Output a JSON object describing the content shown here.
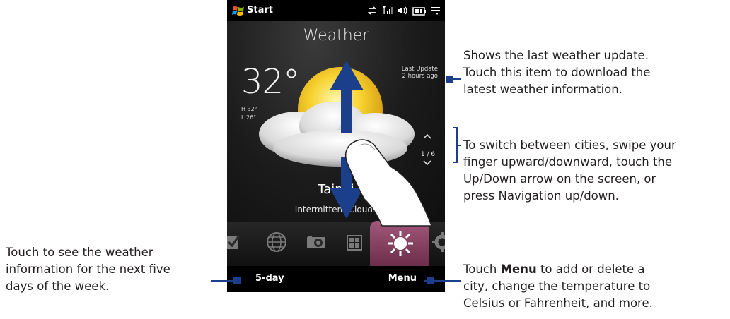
{
  "status_bar": {
    "start_label": "Start"
  },
  "weather": {
    "title": "Weather",
    "temperature": "32°",
    "high": "H 32°",
    "low": "L 26°",
    "last_update_line1": "Last Update",
    "last_update_line2": "2 hours ago",
    "city_page": "1 / 6",
    "city": "Taipei",
    "condition": "Intermittent Clouds"
  },
  "soft_keys": {
    "left": "5-day",
    "right": "Menu"
  },
  "callouts": {
    "last_update": [
      "Shows the last weather update.",
      "Touch this item to download the",
      "latest weather information."
    ],
    "switch_cities": [
      "To switch between cities, swipe your",
      "finger upward/downward, touch the",
      "Up/Down arrow on the screen, or",
      "press Navigation up/down."
    ],
    "five_day": [
      "Touch to see the weather",
      "information for the next five",
      "days of the week."
    ],
    "menu_prefix": "Touch ",
    "menu_bold": "Menu",
    "menu_line1_suffix": " to add or delete a",
    "menu_rest": [
      "city, change the temperature to",
      "Celsius or Fahrenheit, and more."
    ]
  },
  "colors": {
    "callout_line": "#1b3f8b",
    "arrow": "#1b3f8b",
    "active_tab": "#8a3f63"
  },
  "icons": [
    "windows-flag-icon",
    "sync-icon",
    "signal-icon",
    "volume-icon",
    "battery-icon",
    "menu-lines-icon",
    "checkbox-tab-icon",
    "internet-tab-icon",
    "camera-tab-icon",
    "apps-tab-icon",
    "weather-tab-icon",
    "settings-tab-icon",
    "up-arrow-icon",
    "down-arrow-icon",
    "finger-icon",
    "sun-cloud-icon"
  ]
}
